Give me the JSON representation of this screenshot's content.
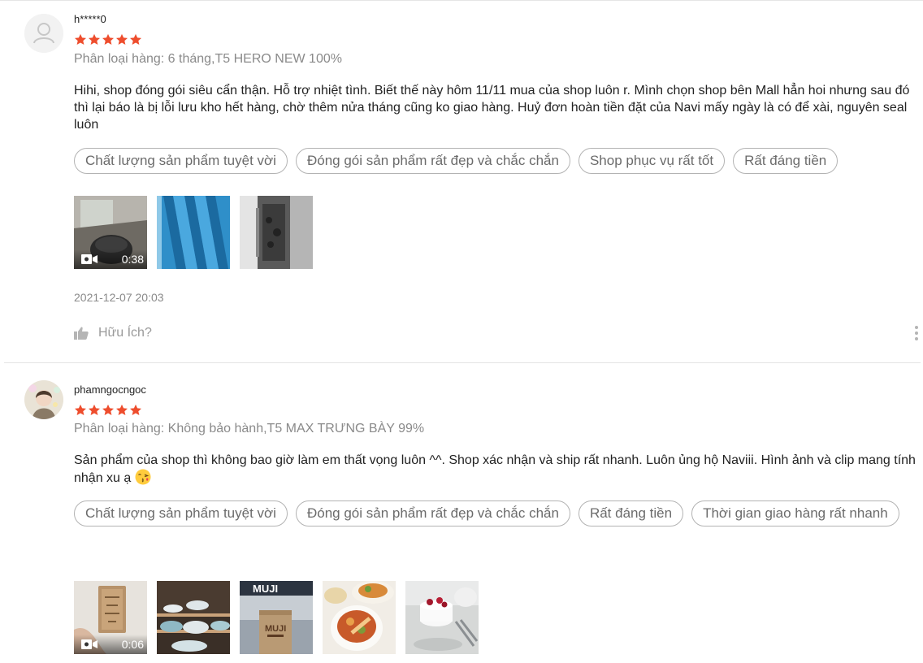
{
  "reviews": [
    {
      "username": "h*****0",
      "rating": 5,
      "variation": "Phân loại hàng: 6 tháng,T5 HERO NEW 100%",
      "content": "Hihi, shop đóng gói siêu cẩn thận. Hỗ trợ nhiệt tình. Biết thế này hôm 11/11 mua của shop luôn r. Mình chọn shop bên Mall hẳn hoi nhưng sau đó thì lại báo là bị lỗi lưu kho hết hàng, chờ thêm nửa tháng cũng ko giao hàng. Huỷ đơn hoàn tiền đặt của Navi mấy ngày là có để xài, nguyên seal luôn",
      "tags": [
        "Chất lượng sản phẩm tuyệt vời",
        "Đóng gói sản phẩm rất đẹp và chắc chắn",
        "Shop phục vụ rất tốt",
        "Rất đáng tiền"
      ],
      "video_duration": "0:38",
      "date": "2021-12-07 20:03",
      "helpful_label": "Hữu Ích?"
    },
    {
      "username": "phamngocngoc",
      "rating": 5,
      "variation": "Phân loại hàng: Không bảo hành,T5 MAX TRƯNG BÀY 99%",
      "content": "Sản phẩm của shop thì không bao giờ làm em thất vọng luôn ^^. Shop xác nhận và ship rất nhanh. Luôn ủng hộ Naviii. Hình ảnh và clip mang tính nhận xu ạ",
      "tags": [
        "Chất lượng sản phẩm tuyệt vời",
        "Đóng gói sản phẩm rất đẹp và chắc chắn",
        "Rất đáng tiền",
        "Thời gian giao hàng rất nhanh"
      ],
      "video_duration": "0:06",
      "photo_text": "MUJI"
    }
  ],
  "icons": {
    "star": "star-icon",
    "video": "video-camera-icon",
    "like": "thumbs-up-icon",
    "more": "more-vertical-icon",
    "emoji": "kissing-face-emoji"
  },
  "colors": {
    "star": "#ee4d2d",
    "tag_border": "#b3b3b3",
    "muted_text": "#8a8a8a"
  }
}
